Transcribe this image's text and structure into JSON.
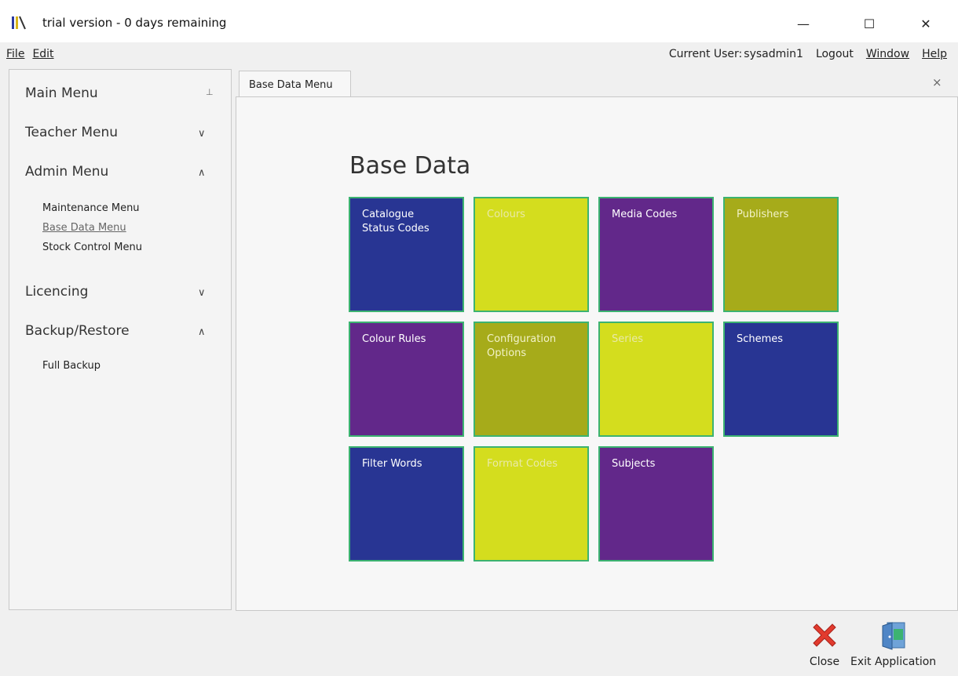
{
  "window": {
    "title": "trial version - 0 days remaining",
    "minimize_glyph": "—",
    "maximize_glyph": "☐",
    "close_glyph": "✕"
  },
  "menubar": {
    "file": "File",
    "edit": "Edit",
    "current_user_label": "Current User:",
    "current_user_name": "sysadmin1",
    "logout": "Logout",
    "window": "Window",
    "help": "Help"
  },
  "sidebar": {
    "main_menu": "Main Menu",
    "pin_glyph": "⊥",
    "teacher_menu": "Teacher Menu",
    "admin_menu": "Admin Menu",
    "admin_items": [
      "Maintenance Menu",
      "Base Data Menu",
      "Stock Control Menu"
    ],
    "licencing": "Licencing",
    "backup_restore": "Backup/Restore",
    "backup_items": [
      "Full Backup"
    ],
    "chevron_down": "∨",
    "chevron_up": "∧"
  },
  "tab": {
    "label": "Base Data Menu",
    "close_glyph": "×"
  },
  "main": {
    "title": "Base Data",
    "tiles": [
      {
        "label": "Catalogue Status Codes",
        "color": "#283593"
      },
      {
        "label": "Colours",
        "color": "#d4dd1e"
      },
      {
        "label": "Media Codes",
        "color": "#62288a"
      },
      {
        "label": "Publishers",
        "color": "#a6ab1a"
      },
      {
        "label": "Colour Rules",
        "color": "#62288a"
      },
      {
        "label": "Configuration Options",
        "color": "#a6ab1a"
      },
      {
        "label": "Series",
        "color": "#d4dd1e"
      },
      {
        "label": "Schemes",
        "color": "#283593"
      },
      {
        "label": "Filter Words",
        "color": "#283593"
      },
      {
        "label": "Format Codes",
        "color": "#d4dd1e"
      },
      {
        "label": "Subjects",
        "color": "#62288a"
      }
    ]
  },
  "bottom": {
    "close": "Close",
    "exit": "Exit Application"
  },
  "colors": {
    "tile_border": "#3cb371",
    "navy": "#283593",
    "lime": "#d4dd1e",
    "purple": "#62288a",
    "olive": "#a6ab1a"
  }
}
